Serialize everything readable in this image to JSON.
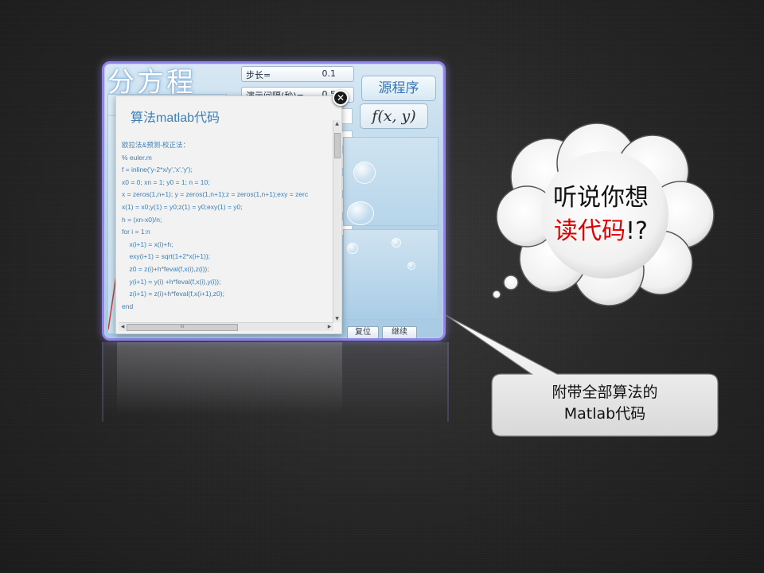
{
  "app": {
    "title": "分方程",
    "params": [
      {
        "key": "步长=",
        "value": "0.1"
      },
      {
        "key": "演示间隔(秒)=",
        "value": "0.5"
      }
    ],
    "source_button": "源程序",
    "fxy_button": "f(x, y)",
    "bottom_buttons": [
      "复位",
      "继续"
    ]
  },
  "popup": {
    "title": "算法matlab代码",
    "close_icon": "close-icon",
    "code_lines": [
      "欧拉法&预测-校正法：",
      "% euler.m",
      "f = inline('y-2*x/y','x','y');",
      "x0 = 0; xn = 1; y0 = 1; n = 10;",
      "x = zeros(1,n+1); y = zeros(1,n+1);z = zeros(1,n+1);exy = zerc",
      "x(1) = x0;y(1) = y0;z(1) = y0;exy(1) = y0;",
      "h = (xn-x0)/n;",
      "for i = 1:n",
      "    x(i+1) = x(i)+h;",
      "    exy(i+1) = sqrt(1+2*x(i+1));",
      "    z0 = z(i)+h*feval(f,x(i),z(i));",
      "    y(i+1) = y(i) +h*feval(f,x(i),y(i));",
      "    z(i+1) = z(i)+h*feval(f,x(i+1),z0);",
      "end"
    ]
  },
  "cloud": {
    "line1": "听说你想",
    "line2_red": "读代码",
    "line2_rest": "!?"
  },
  "callout": {
    "line1": "附带全部算法的",
    "line2": "Matlab代码"
  },
  "colors": {
    "app_border": "#8f86e8",
    "code_text": "#3d7fb8",
    "accent_red": "#e00000"
  }
}
